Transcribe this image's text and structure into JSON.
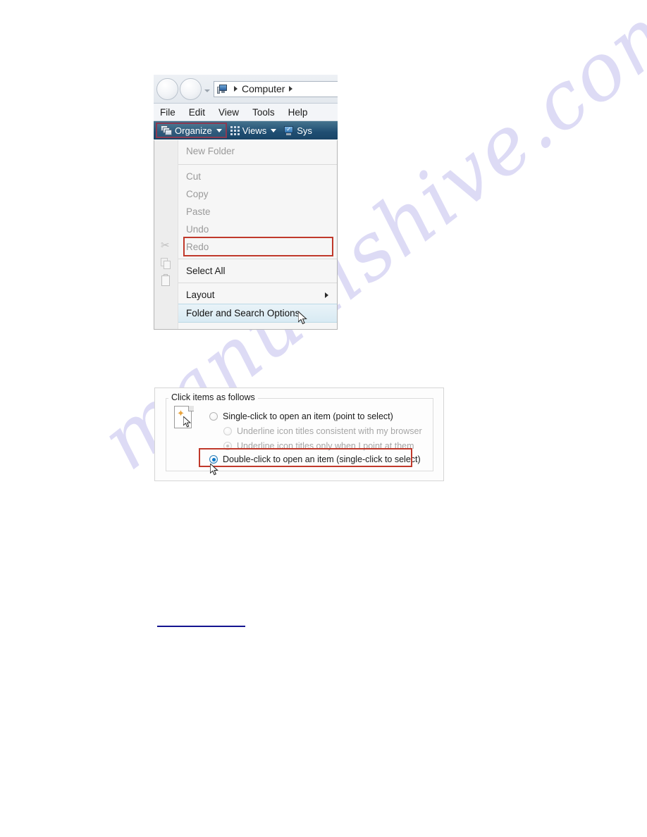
{
  "watermark": {
    "text": "manualshive.com",
    "color": "#c9c6ef"
  },
  "accents": {
    "highlight_red": "#c0392b",
    "toolbar_blue": "#1f4e72",
    "selected_radio_blue": "#0a76c8",
    "link_blue": "#141490"
  },
  "explorer": {
    "address_bar": {
      "back_button": "back-button",
      "forward_button": "forward-button",
      "history_dropdown": "history-dropdown",
      "computer_icon": "computer-icon",
      "breadcrumb": "Computer",
      "leading_separator": "▸",
      "trailing_separator": "▸"
    },
    "menu_bar": {
      "items": [
        {
          "label": "File"
        },
        {
          "label": "Edit"
        },
        {
          "label": "View"
        },
        {
          "label": "Tools"
        },
        {
          "label": "Help"
        }
      ]
    },
    "toolbar": {
      "organize": {
        "label": "Organize",
        "icon": "organize-icon",
        "caret": "chevron-down-icon",
        "highlighted": true
      },
      "views": {
        "label": "Views",
        "icon": "views-grid-icon",
        "caret": "chevron-down-icon"
      },
      "system": {
        "label": "Sys",
        "icon": "system-properties-icon"
      }
    },
    "organize_menu": {
      "items": [
        {
          "label": "New Folder",
          "enabled": false,
          "icon": null
        },
        {
          "label": "Cut",
          "enabled": false,
          "icon": "scissors-icon"
        },
        {
          "label": "Copy",
          "enabled": false,
          "icon": "copy-icon"
        },
        {
          "label": "Paste",
          "enabled": false,
          "icon": "paste-icon"
        },
        {
          "label": "Undo",
          "enabled": false,
          "icon": null
        },
        {
          "label": "Redo",
          "enabled": false,
          "icon": null
        },
        {
          "label": "Select All",
          "enabled": true,
          "icon": null
        },
        {
          "label": "Layout",
          "enabled": true,
          "icon": "layout-icon",
          "submenu_arrow": "▸"
        },
        {
          "label": "Folder and Search Options",
          "enabled": true,
          "icon": null,
          "highlighted": true
        }
      ]
    }
  },
  "folder_options": {
    "group_title": "Click items as follows",
    "preview_icon": "click-preview-icon",
    "options": [
      {
        "label": "Single-click to open an item (point to select)",
        "underlined_letter": "S",
        "state": "unselected",
        "muted": false,
        "indent": 0
      },
      {
        "label": "Underline icon titles consistent with my browser",
        "underlined_letter": "b",
        "state": "unselected",
        "muted": true,
        "indent": 1
      },
      {
        "label": "Underline icon titles only when I point at them",
        "underlined_letter": "p",
        "state": "semi-selected",
        "muted": true,
        "indent": 1
      },
      {
        "label": "Double-click to open an item (single-click to select)",
        "underlined_letter": "D",
        "state": "selected",
        "muted": false,
        "indent": 0,
        "highlighted": true
      }
    ]
  }
}
